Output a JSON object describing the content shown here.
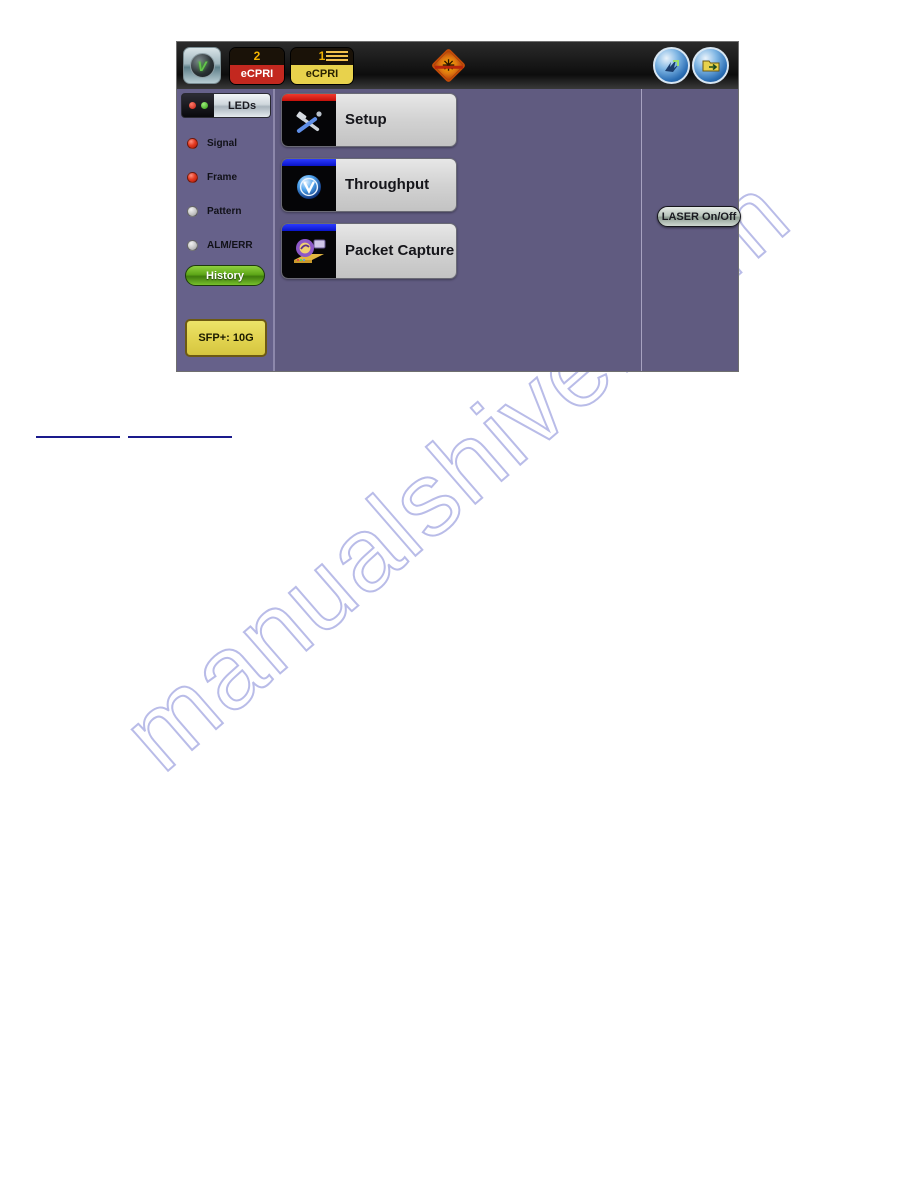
{
  "device": {
    "toolbar": {
      "app_logo": {
        "name": "vepal-logo-icon",
        "glyph": "V"
      },
      "ports": [
        {
          "number": "2",
          "label": "eCPRI",
          "state": "inactive",
          "color": "#c3281f"
        },
        {
          "number": "1",
          "label": "eCPRI",
          "state": "active",
          "color": "#e8d24c"
        }
      ],
      "laser_warning": {
        "name": "laser-off-warning-icon",
        "color": "#e07a10"
      },
      "right_icons": [
        {
          "name": "signal-status-icon"
        },
        {
          "name": "file-export-icon"
        }
      ]
    },
    "led_panel": {
      "header_label": "LEDs",
      "indicators": [
        {
          "label": "Signal",
          "state": "on",
          "color": "#e43b22"
        },
        {
          "label": "Frame",
          "state": "on",
          "color": "#e43b22"
        },
        {
          "label": "Pattern",
          "state": "off",
          "color": "#c9c9c9"
        },
        {
          "label": "ALM/ERR",
          "state": "off",
          "color": "#c9c9c9"
        }
      ],
      "history_button": "History",
      "sfp_badge": "SFP+: 10G"
    },
    "menu": {
      "items": [
        {
          "label": "Setup",
          "icon": "hammer-screwdriver-icon",
          "accent": "#e01b12"
        },
        {
          "label": "Throughput",
          "icon": "throughput-orb-icon",
          "accent": "#1522f0"
        },
        {
          "label": "Packet Capture",
          "icon": "packet-capture-icon",
          "accent": "#1522f0"
        }
      ]
    },
    "right_panel": {
      "laser_button": "LASER On/Off"
    },
    "colors": {
      "screen_background": "#605b80",
      "led_panel_background": "#66618a",
      "toolbar_background": "#1a1a1a"
    }
  },
  "page": {
    "watermark": "manualshive.com",
    "links": [
      {
        "name": "footer-link-1",
        "label": ""
      },
      {
        "name": "footer-link-2",
        "label": ""
      }
    ]
  }
}
